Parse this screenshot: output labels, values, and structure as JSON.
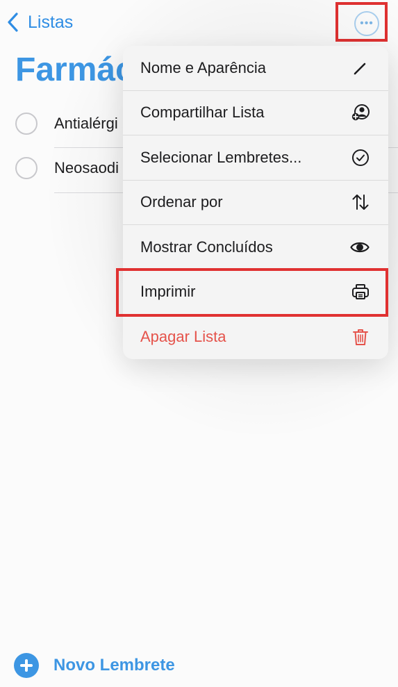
{
  "nav": {
    "back_label": "Listas",
    "more_icon": "ellipsis-circle-icon"
  },
  "list": {
    "title": "Farmác",
    "items": [
      {
        "text": "Antialérgi"
      },
      {
        "text": "Neosaodi"
      }
    ]
  },
  "menu": {
    "items": [
      {
        "label": "Nome e Aparência",
        "icon": "pencil-icon"
      },
      {
        "label": "Compartilhar Lista",
        "icon": "person-add-icon"
      },
      {
        "label": "Selecionar Lembretes...",
        "icon": "checkmark-circle-icon"
      },
      {
        "label": "Ordenar por",
        "icon": "sort-arrows-icon"
      },
      {
        "label": "Mostrar Concluídos",
        "icon": "eye-icon"
      },
      {
        "label": "Imprimir",
        "icon": "printer-icon"
      },
      {
        "label": "Apagar Lista",
        "icon": "trash-icon"
      }
    ]
  },
  "footer": {
    "add_label": "Novo Lembrete"
  },
  "colors": {
    "accent": "#3d96e3",
    "danger": "#e5534b",
    "highlight": "#e03131"
  }
}
